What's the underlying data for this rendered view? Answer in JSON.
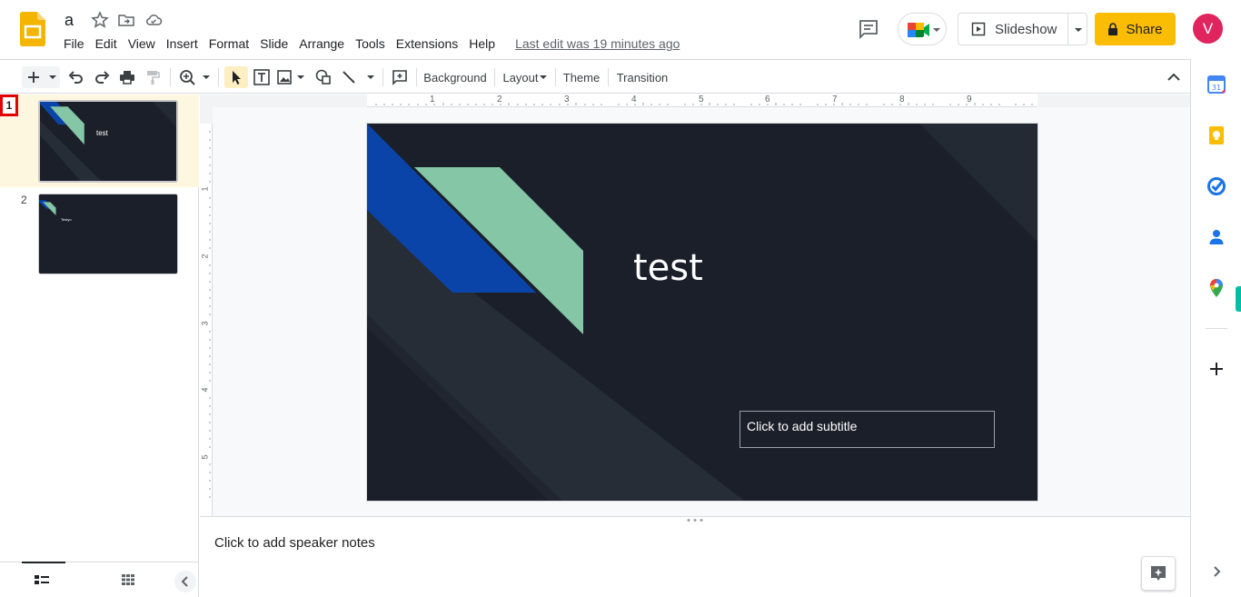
{
  "header": {
    "doc_title": "a",
    "menu": [
      "File",
      "Edit",
      "View",
      "Insert",
      "Format",
      "Slide",
      "Arrange",
      "Tools",
      "Extensions",
      "Help"
    ],
    "last_edit": "Last edit was 19 minutes ago",
    "slideshow_label": "Slideshow",
    "share_label": "Share",
    "avatar_letter": "V"
  },
  "toolbar": {
    "background_label": "Background",
    "layout_label": "Layout",
    "theme_label": "Theme",
    "transition_label": "Transition"
  },
  "filmstrip": {
    "slides": [
      {
        "number": "1",
        "title": "test"
      },
      {
        "number": "2",
        "title": "Testyo"
      }
    ]
  },
  "ruler": {
    "h_labels": [
      "1",
      "2",
      "3",
      "4",
      "5",
      "6",
      "7",
      "8",
      "9"
    ],
    "v_labels": [
      "1",
      "2",
      "3",
      "4",
      "5"
    ]
  },
  "slide": {
    "title": "test",
    "subtitle_placeholder": "Click to add subtitle"
  },
  "notes": {
    "placeholder": "Click to add speaker notes"
  },
  "colors": {
    "slide_bg": "#1b1f29",
    "accent_blue": "#0b44a8",
    "accent_green": "#84c6a6",
    "share_yellow": "#fbbc04",
    "avatar_pink": "#e0245e"
  }
}
